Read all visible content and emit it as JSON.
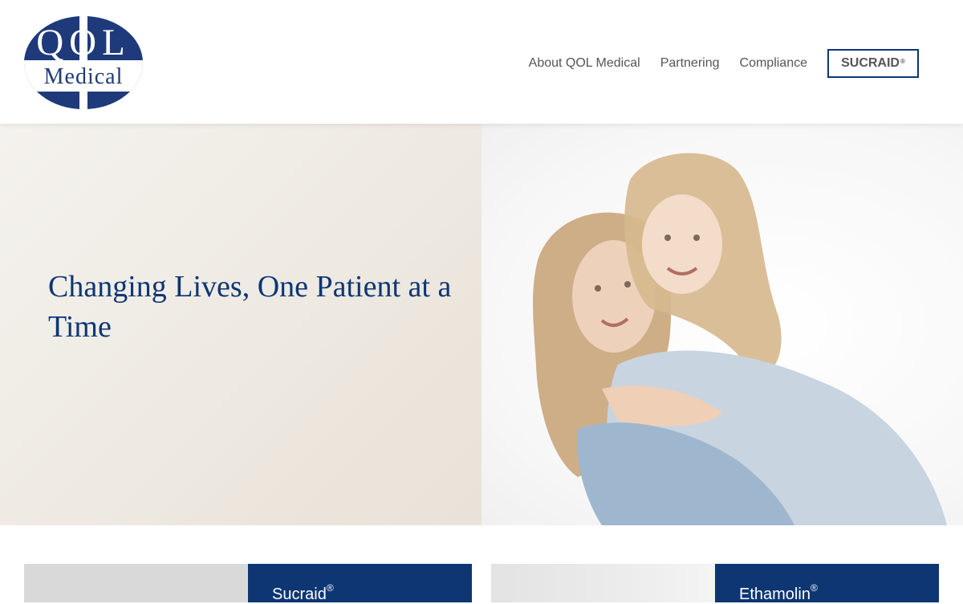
{
  "brand": {
    "logo_top": "QOL",
    "logo_bottom": "Medical",
    "logo_color": "#1f3a7a"
  },
  "nav": {
    "items": [
      {
        "label": "About QOL Medical"
      },
      {
        "label": "Partnering"
      },
      {
        "label": "Compliance"
      }
    ],
    "cta_label": "SUCRAID",
    "cta_mark": "®"
  },
  "hero": {
    "title": "Changing Lives, One Patient at a Time",
    "image_alt": "Mother and daughter hugging"
  },
  "cards": [
    {
      "title": "Sucraid",
      "mark": "®"
    },
    {
      "title": "Ethamolin",
      "mark": "®"
    }
  ],
  "colors": {
    "primary": "#0d3673",
    "nav_text": "#555555",
    "hero_bg": "#efebe4"
  }
}
